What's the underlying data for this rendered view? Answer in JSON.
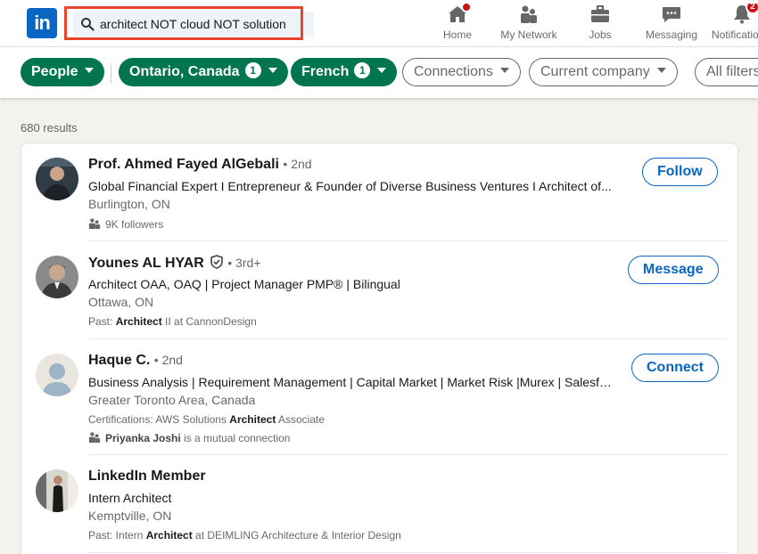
{
  "brand": {
    "logo_text": "in",
    "color": "#0a66c2"
  },
  "search": {
    "value": "architect NOT cloud NOT solution",
    "placeholder": "Search"
  },
  "nav": {
    "items": [
      {
        "label": "Home",
        "icon": "home-icon",
        "badge": "dot"
      },
      {
        "label": "My Network",
        "icon": "network-icon"
      },
      {
        "label": "Jobs",
        "icon": "briefcase-icon"
      },
      {
        "label": "Messaging",
        "icon": "chat-icon"
      },
      {
        "label": "Notifications",
        "icon": "bell-icon",
        "badge": "2"
      }
    ]
  },
  "filters": {
    "people": "People",
    "location": {
      "label": "Ontario, Canada",
      "count": "1"
    },
    "language": {
      "label": "French",
      "count": "1"
    },
    "connections": "Connections",
    "current_company": "Current company",
    "all_filters": "All filters"
  },
  "colors": {
    "active_chip": "#01754f",
    "accent": "#0a66c2",
    "badge": "#cc1016"
  },
  "results": {
    "count": "680 results",
    "items": [
      {
        "name": "Prof. Ahmed Fayed AlGebali",
        "degree": "• 2nd",
        "headline": "Global Financial Expert I Entrepreneur & Founder of Diverse Business Ventures I Architect of...",
        "location": "Burlington, ON",
        "meta": "9K followers",
        "action": "Follow"
      },
      {
        "name": "Younes AL HYAR",
        "degree": "• 3rd+",
        "headline": "Architect OAA, OAQ | Project Manager PMP® | Bilingual",
        "location": "Ottawa, ON",
        "meta_prefix": "Past: ",
        "meta_bold": "Architect",
        "meta_suffix": " II at CannonDesign",
        "action": "Message"
      },
      {
        "name": "Haque C.",
        "degree": "• 2nd",
        "headline": "Business Analysis | Requirement Management | Capital Market | Market Risk |Murex | Salesfor...",
        "location": "Greater Toronto Area, Canada",
        "meta_prefix": "Certifications: AWS Solutions ",
        "meta_bold": "Architect",
        "meta_suffix": " Associate",
        "mutual_bold": "Priyanka Joshi",
        "mutual_suffix": " is a mutual connection",
        "action": "Connect"
      },
      {
        "name": "LinkedIn Member",
        "headline": "Intern Architect",
        "location": "Kemptville, ON",
        "meta_prefix": "Past: Intern ",
        "meta_bold": "Architect",
        "meta_suffix": " at DEIMLING Architecture & Interior Design"
      }
    ]
  }
}
